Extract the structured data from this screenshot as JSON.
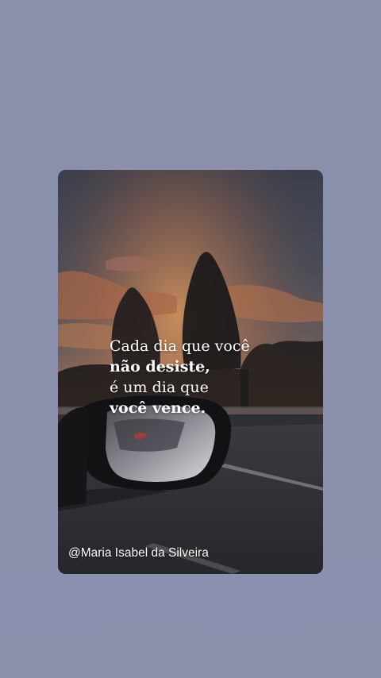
{
  "story": {
    "quote": {
      "line1": "Cada dia que você",
      "line2": "não  desiste,",
      "line3": "é um dia que",
      "line4": "você vence."
    },
    "credit": "@Maria Isabel da Silveira"
  },
  "colors": {
    "page_background": "#8a8fac",
    "sky_top": "#3f4250",
    "sunset_glow": "#e0894a",
    "text": "#ffffff"
  }
}
